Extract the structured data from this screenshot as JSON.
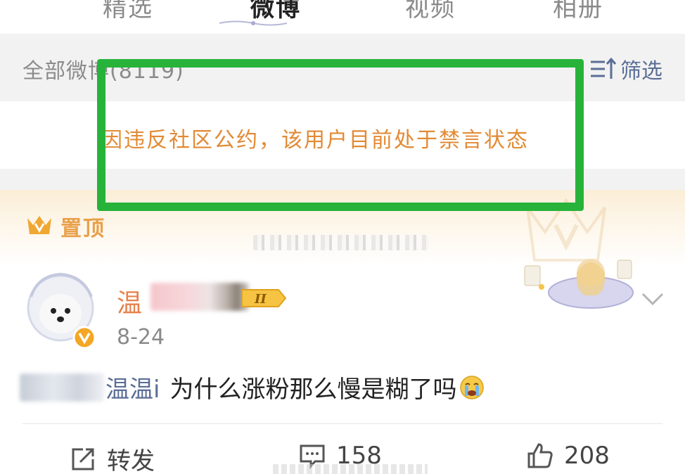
{
  "tabs": [
    {
      "label": "精选",
      "active": false
    },
    {
      "label": "微博",
      "active": true
    },
    {
      "label": "视频",
      "active": false
    },
    {
      "label": "相册",
      "active": false
    }
  ],
  "filter_bar": {
    "all_posts_label": "全部微博(8119)",
    "filter_label": "筛选",
    "filter_icon": "sort-filter-icon"
  },
  "notice": {
    "text": "因违反社区公约，该用户目前处于禁言状态"
  },
  "pinned": {
    "label": "置顶",
    "icon": "crown-icon"
  },
  "post": {
    "username_visible": "温",
    "level_badge": "II",
    "date": "8-24",
    "mention_visible": "温温i",
    "text": "为什么涨粉那么慢是糊了吗",
    "emoji": "crying-face",
    "actions": {
      "repost_label": "转发",
      "comment_count": "158",
      "like_count": "208"
    }
  },
  "colors": {
    "highlight": "#27b33a",
    "notice": "#e28a34",
    "link": "#5b6e96",
    "username": "#e8804a",
    "pinned": "#e8a14b"
  }
}
